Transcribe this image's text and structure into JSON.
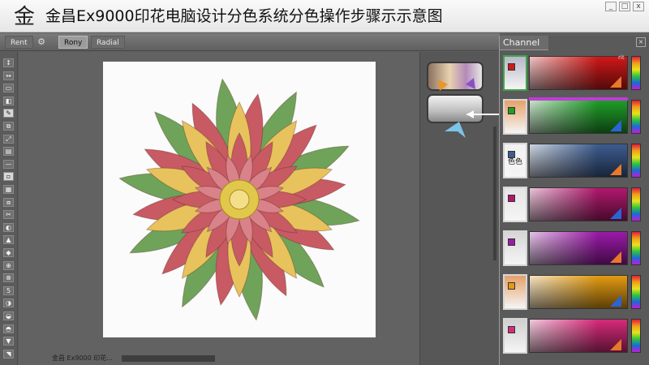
{
  "window": {
    "logo_char": "金",
    "title": "金昌Ex9000印花电脑设计分色系统分色操作步骤示示意图",
    "controls": [
      "_",
      "□",
      "x"
    ]
  },
  "tabs": [
    {
      "label": "Rent",
      "active": false
    },
    {
      "label": "Rony",
      "active": true
    },
    {
      "label": "Radial",
      "active": false
    }
  ],
  "left_tools": [
    "↕",
    "↔",
    "▭",
    "◧",
    "✎",
    "⧉",
    "⤢",
    "▤",
    "—",
    "▫",
    "▦",
    "⧈",
    "✂",
    "◐",
    "▲",
    "◆",
    "⊕",
    "⊗",
    "5",
    "◑",
    "◒",
    "◓",
    "▼",
    "◥"
  ],
  "status": {
    "text": "金昌 Ex9000 印花..."
  },
  "channel_panel": {
    "title": "Channel",
    "rows": [
      {
        "label": "",
        "small": "rit",
        "swatch": "#d01818",
        "thumb": "#b7b7c8",
        "selected": true
      },
      {
        "label": "",
        "small": "",
        "swatch": "#1f9d28",
        "thumb": "#e6a16a",
        "selected": false,
        "slider": true
      },
      {
        "label": "色色",
        "small": "",
        "swatch": "#3d5c8f",
        "thumb": "#f2f2f2",
        "selected": false
      },
      {
        "label": "",
        "small": "",
        "swatch": "#b0186d",
        "thumb": "#e5e5e5",
        "selected": false
      },
      {
        "label": "",
        "small": "",
        "swatch": "#9b1aa8",
        "thumb": "#d6d6d6",
        "selected": false
      },
      {
        "label": "",
        "small": "",
        "swatch": "#e39b12",
        "thumb": "#e6a06a",
        "selected": false
      },
      {
        "label": "",
        "small": "",
        "swatch": "#d62b7a",
        "thumb": "#cfcfcf",
        "selected": false
      }
    ]
  },
  "colors": {
    "petal_red": "#c85a63",
    "petal_yellow": "#e8c25c",
    "leaf_green": "#6fa35a",
    "center": "#e1c84a",
    "annotation_arrow": "#7cc3e8"
  }
}
